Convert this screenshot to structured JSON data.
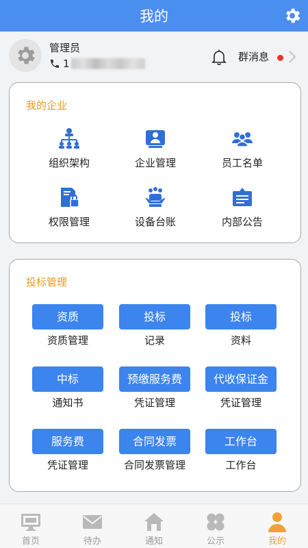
{
  "header": {
    "title": "我的",
    "settings_icon": "gear-icon"
  },
  "profile": {
    "name": "管理员",
    "phone_prefix": "1",
    "group_message_label": "群消息",
    "unread_dot_color": "#e8352b"
  },
  "enterprise": {
    "title": "我的企业",
    "items": [
      {
        "label": "组织架构",
        "icon": "org-structure-icon"
      },
      {
        "label": "企业管理",
        "icon": "enterprise-icon"
      },
      {
        "label": "员工名单",
        "icon": "staff-icon"
      },
      {
        "label": "权限管理",
        "icon": "permission-icon"
      },
      {
        "label": "设备台账",
        "icon": "device-icon"
      },
      {
        "label": "内部公告",
        "icon": "notice-board-icon"
      }
    ]
  },
  "bidding": {
    "title": "投标管理",
    "items": [
      {
        "button": "资质",
        "caption": "资质管理"
      },
      {
        "button": "投标",
        "caption": "记录"
      },
      {
        "button": "投标",
        "caption": "资料"
      },
      {
        "button": "中标",
        "caption": "通知书"
      },
      {
        "button": "预缴服务费",
        "caption": "凭证管理"
      },
      {
        "button": "代收保证金",
        "caption": "凭证管理"
      },
      {
        "button": "服务费",
        "caption": "凭证管理"
      },
      {
        "button": "合同发票",
        "caption": "合同发票管理"
      },
      {
        "button": "工作台",
        "caption": "工作台"
      }
    ]
  },
  "tabbar": {
    "items": [
      {
        "label": "首页",
        "icon": "monitor-icon"
      },
      {
        "label": "待办",
        "icon": "mail-icon"
      },
      {
        "label": "通知",
        "icon": "home-icon"
      },
      {
        "label": "公示",
        "icon": "apps-icon"
      },
      {
        "label": "我的",
        "icon": "user-icon",
        "active": true
      }
    ]
  },
  "colors": {
    "primary": "#4a8ef0",
    "button": "#3c84ee",
    "section_title": "#e79a25",
    "active_tab": "#f0a23a"
  }
}
